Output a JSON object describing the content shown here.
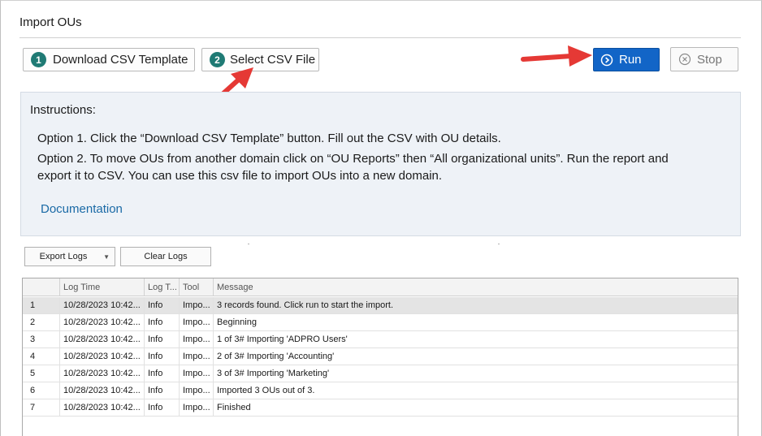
{
  "window": {
    "title": "Import OUs"
  },
  "toolbar": {
    "download": {
      "step": "1",
      "label": "Download CSV Template"
    },
    "select": {
      "step": "2",
      "label": "Select CSV File"
    },
    "run_label": "Run",
    "stop_label": "Stop"
  },
  "instructions": {
    "heading": "Instructions:",
    "option1": "Option 1. Click the “Download CSV Template” button. Fill out the CSV with OU details.",
    "option2_line1": "Option 2. To move OUs from another domain click on “OU Reports” then “All organizational units”. Run the report and",
    "option2_line2": "export it to CSV. You can use this csv file to import OUs into a new domain.",
    "documentation_link": "Documentation"
  },
  "log_controls": {
    "export_label": "Export Logs",
    "clear_label": "Clear Logs"
  },
  "log_grid": {
    "columns": [
      "Log Time",
      "Log T...",
      "Tool",
      "Message"
    ],
    "rows": [
      {
        "num": "1",
        "time": "10/28/2023 10:42...",
        "type": "Info",
        "tool": "Impo...",
        "message": "3 records found. Click run to start the import."
      },
      {
        "num": "2",
        "time": "10/28/2023 10:42...",
        "type": "Info",
        "tool": "Impo...",
        "message": "Beginning"
      },
      {
        "num": "3",
        "time": "10/28/2023 10:42...",
        "type": "Info",
        "tool": "Impo...",
        "message": "1 of 3# Importing 'ADPRO Users'"
      },
      {
        "num": "4",
        "time": "10/28/2023 10:42...",
        "type": "Info",
        "tool": "Impo...",
        "message": "2 of 3# Importing 'Accounting'"
      },
      {
        "num": "5",
        "time": "10/28/2023 10:42...",
        "type": "Info",
        "tool": "Impo...",
        "message": "3 of 3# Importing 'Marketing'"
      },
      {
        "num": "6",
        "time": "10/28/2023 10:42...",
        "type": "Info",
        "tool": "Impo...",
        "message": "Imported 3 OUs out of 3."
      },
      {
        "num": "7",
        "time": "10/28/2023 10:42...",
        "type": "Info",
        "tool": "Impo...",
        "message": "Finished"
      }
    ]
  },
  "colors": {
    "accent": "#1265c7",
    "step_badge": "#1f7a74",
    "link": "#1a6aa6",
    "annotation_arrow": "#e53935"
  },
  "icons": {
    "run": "play-circle-icon",
    "stop": "stop-circle-icon",
    "export_dropdown": "caret-down-icon"
  }
}
